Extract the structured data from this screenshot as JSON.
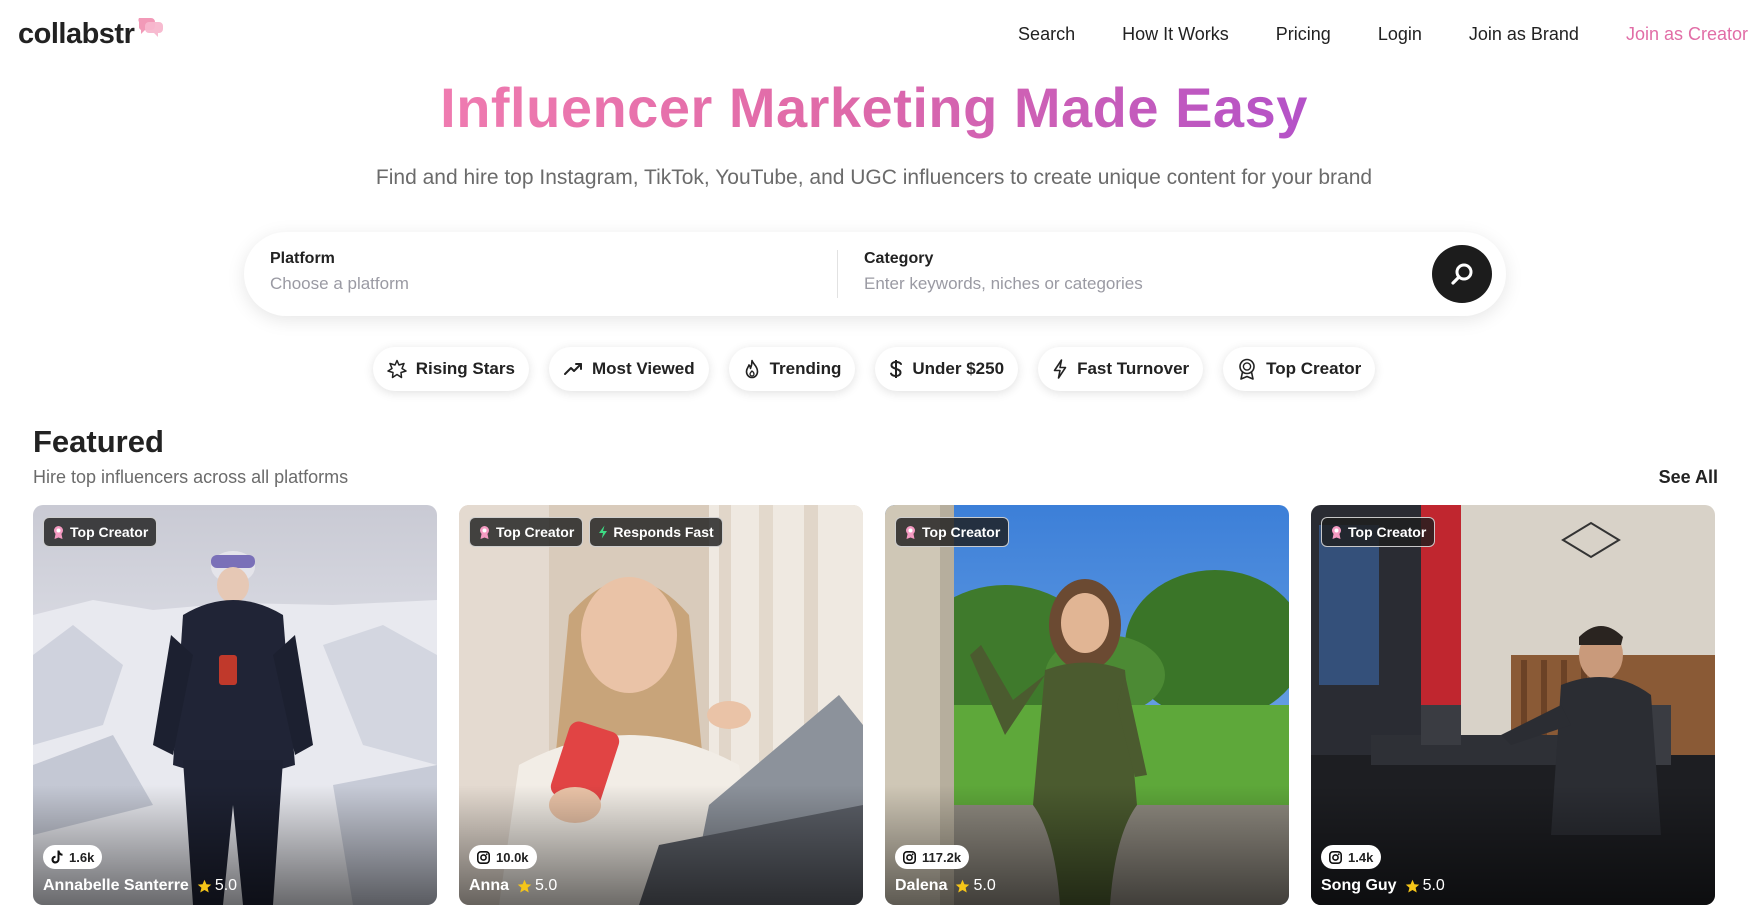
{
  "header": {
    "logo": "collabstr",
    "nav": [
      {
        "label": "Search"
      },
      {
        "label": "How It Works"
      },
      {
        "label": "Pricing"
      },
      {
        "label": "Login"
      },
      {
        "label": "Join as Brand"
      },
      {
        "label": "Join as Creator"
      }
    ]
  },
  "hero": {
    "title": "Influencer Marketing Made Easy",
    "subtitle": "Find and hire top Instagram, TikTok, YouTube, and UGC influencers to create unique content for your brand"
  },
  "search": {
    "platform_label": "Platform",
    "platform_placeholder": "Choose a platform",
    "category_label": "Category",
    "category_placeholder": "Enter keywords, niches or categories",
    "button_icon": "search-icon"
  },
  "chips": [
    {
      "label": "Rising Stars",
      "icon": "sparkle-icon"
    },
    {
      "label": "Most Viewed",
      "icon": "trending-up-icon"
    },
    {
      "label": "Trending",
      "icon": "flame-icon"
    },
    {
      "label": "Under $250",
      "icon": "dollar-icon"
    },
    {
      "label": "Fast Turnover",
      "icon": "lightning-icon"
    },
    {
      "label": "Top Creator",
      "icon": "award-icon"
    }
  ],
  "featured": {
    "title": "Featured",
    "subtitle": "Hire top influencers across all platforms",
    "see_all": "See All",
    "cards": [
      {
        "name": "Annabelle Santerre",
        "rating": "5.0",
        "followers": "1.6k",
        "platform": "tiktok-icon",
        "badges": [
          "Top Creator"
        ]
      },
      {
        "name": "Anna",
        "rating": "5.0",
        "followers": "10.0k",
        "platform": "instagram-icon",
        "badges": [
          "Top Creator",
          "Responds Fast"
        ]
      },
      {
        "name": "Dalena",
        "rating": "5.0",
        "followers": "117.2k",
        "platform": "instagram-icon",
        "badges": [
          "Top Creator"
        ]
      },
      {
        "name": "Song Guy",
        "rating": "5.0",
        "followers": "1.4k",
        "platform": "instagram-icon",
        "badges": [
          "Top Creator"
        ]
      }
    ]
  },
  "colors": {
    "accent_pink": "#e16da6",
    "gradient_start": "#ef7bb0",
    "gradient_end": "#b452c8",
    "star": "#f5c518",
    "responds_fast_bolt": "#3ddc84"
  }
}
